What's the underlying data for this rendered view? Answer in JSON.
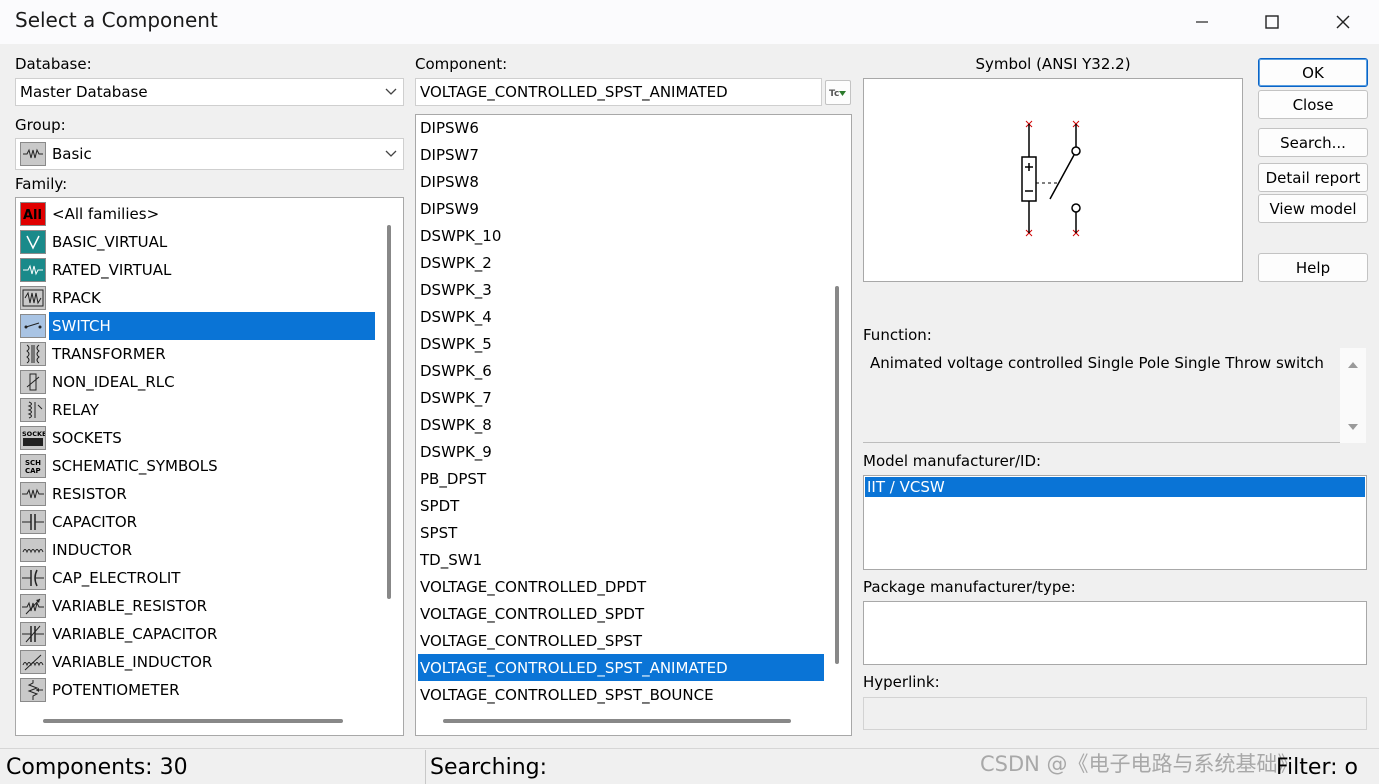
{
  "window": {
    "title": "Select a Component"
  },
  "database": {
    "label": "Database:",
    "value": "Master Database"
  },
  "group": {
    "label": "Group:",
    "value": "Basic",
    "icon": "basic-group-icon"
  },
  "family": {
    "label": "Family:",
    "items": [
      {
        "label": "<All families>",
        "icon": "all-families-icon",
        "selected": false
      },
      {
        "label": "BASIC_VIRTUAL",
        "icon": "basic-virtual-icon",
        "selected": false
      },
      {
        "label": "RATED_VIRTUAL",
        "icon": "rated-virtual-icon",
        "selected": false
      },
      {
        "label": "RPACK",
        "icon": "rpack-icon",
        "selected": false
      },
      {
        "label": "SWITCH",
        "icon": "switch-icon",
        "selected": true
      },
      {
        "label": "TRANSFORMER",
        "icon": "transformer-icon",
        "selected": false
      },
      {
        "label": "NON_IDEAL_RLC",
        "icon": "non-ideal-rlc-icon",
        "selected": false
      },
      {
        "label": "RELAY",
        "icon": "relay-icon",
        "selected": false
      },
      {
        "label": "SOCKETS",
        "icon": "sockets-icon",
        "selected": false
      },
      {
        "label": "SCHEMATIC_SYMBOLS",
        "icon": "schematic-symbols-icon",
        "selected": false
      },
      {
        "label": "RESISTOR",
        "icon": "resistor-icon",
        "selected": false
      },
      {
        "label": "CAPACITOR",
        "icon": "capacitor-icon",
        "selected": false
      },
      {
        "label": "INDUCTOR",
        "icon": "inductor-icon",
        "selected": false
      },
      {
        "label": "CAP_ELECTROLIT",
        "icon": "cap-electrolit-icon",
        "selected": false
      },
      {
        "label": "VARIABLE_RESISTOR",
        "icon": "variable-resistor-icon",
        "selected": false
      },
      {
        "label": "VARIABLE_CAPACITOR",
        "icon": "variable-capacitor-icon",
        "selected": false
      },
      {
        "label": "VARIABLE_INDUCTOR",
        "icon": "variable-inductor-icon",
        "selected": false
      },
      {
        "label": "POTENTIOMETER",
        "icon": "potentiometer-icon",
        "selected": false
      }
    ]
  },
  "component": {
    "label": "Component:",
    "value": "VOLTAGE_CONTROLLED_SPST_ANIMATED",
    "items": [
      {
        "label": "DIPSW6",
        "selected": false
      },
      {
        "label": "DIPSW7",
        "selected": false
      },
      {
        "label": "DIPSW8",
        "selected": false
      },
      {
        "label": "DIPSW9",
        "selected": false
      },
      {
        "label": "DSWPK_10",
        "selected": false
      },
      {
        "label": "DSWPK_2",
        "selected": false
      },
      {
        "label": "DSWPK_3",
        "selected": false
      },
      {
        "label": "DSWPK_4",
        "selected": false
      },
      {
        "label": "DSWPK_5",
        "selected": false
      },
      {
        "label": "DSWPK_6",
        "selected": false
      },
      {
        "label": "DSWPK_7",
        "selected": false
      },
      {
        "label": "DSWPK_8",
        "selected": false
      },
      {
        "label": "DSWPK_9",
        "selected": false
      },
      {
        "label": "PB_DPST",
        "selected": false
      },
      {
        "label": "SPDT",
        "selected": false
      },
      {
        "label": "SPST",
        "selected": false
      },
      {
        "label": "TD_SW1",
        "selected": false
      },
      {
        "label": "VOLTAGE_CONTROLLED_DPDT",
        "selected": false
      },
      {
        "label": "VOLTAGE_CONTROLLED_SPDT",
        "selected": false
      },
      {
        "label": "VOLTAGE_CONTROLLED_SPST",
        "selected": false
      },
      {
        "label": "VOLTAGE_CONTROLLED_SPST_ANIMATED",
        "selected": true
      },
      {
        "label": "VOLTAGE_CONTROLLED_SPST_BOUNCE",
        "selected": false
      }
    ]
  },
  "symbol": {
    "label": "Symbol (ANSI Y32.2)"
  },
  "buttons": {
    "ok": "OK",
    "close": "Close",
    "search": "Search...",
    "detail_report": "Detail report",
    "view_model": "View model",
    "help": "Help"
  },
  "function": {
    "label": "Function:",
    "text": "Animated voltage controlled Single Pole Single Throw switch"
  },
  "model": {
    "label": "Model manufacturer/ID:",
    "items": [
      "IIT / VCSW"
    ]
  },
  "package": {
    "label": "Package manufacturer/type:"
  },
  "hyperlink": {
    "label": "Hyperlink:"
  },
  "status": {
    "components": "Components: 30",
    "searching": "Searching:",
    "filter": "Filter: o"
  },
  "watermark": "CSDN @《电子电路与系统基础》",
  "colors": {
    "selection": "#0a74d6",
    "symbol_pin_marker": "#d00000"
  }
}
